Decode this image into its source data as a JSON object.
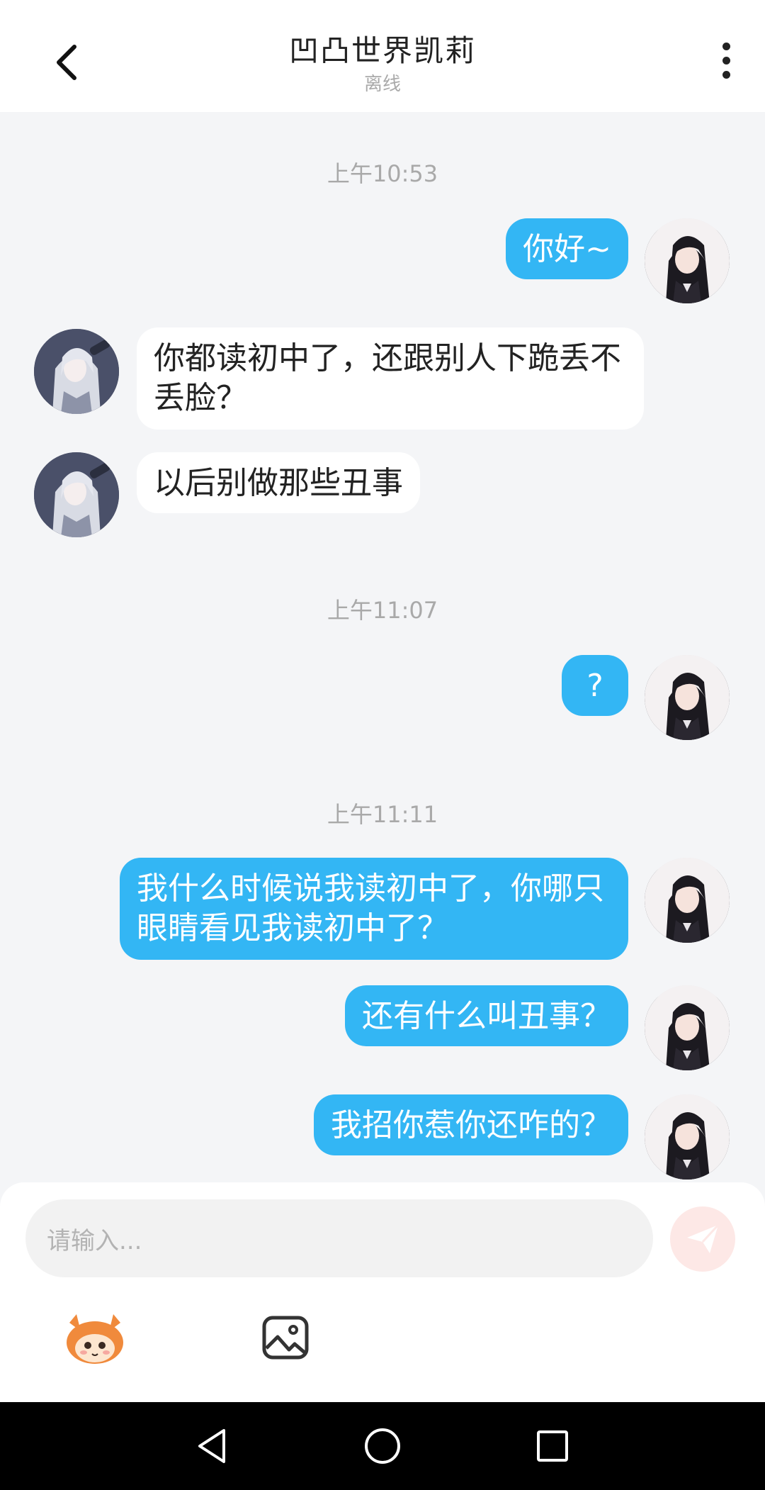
{
  "header": {
    "title": "凹凸世界凯莉",
    "status": "离线"
  },
  "messages": {
    "ts1": "上午10:53",
    "m1": "你好~",
    "m2": "你都读初中了，还跟别人下跪丢不丢脸？",
    "m3": "以后别做那些丑事",
    "ts2": "上午11:07",
    "m4": "?",
    "ts3": "上午11:11",
    "m5": "我什么时候说我读初中了，你哪只眼睛看见我读初中了？",
    "m6": "还有什么叫丑事？",
    "m7": "我招你惹你还咋的？"
  },
  "input": {
    "placeholder": "请输入..."
  },
  "colors": {
    "bubble_me": "#33b6f4",
    "bubble_other": "#ffffff",
    "send_button_bg": "#fde8e6",
    "mascot": "#f08a3c"
  },
  "icons": {
    "back": "chevron-left-icon",
    "more": "more-vertical-icon",
    "send": "paper-plane-icon",
    "sticker": "mascot-icon",
    "image": "image-icon",
    "nav_back": "triangle-back-icon",
    "nav_home": "circle-home-icon",
    "nav_recent": "square-recent-icon"
  }
}
